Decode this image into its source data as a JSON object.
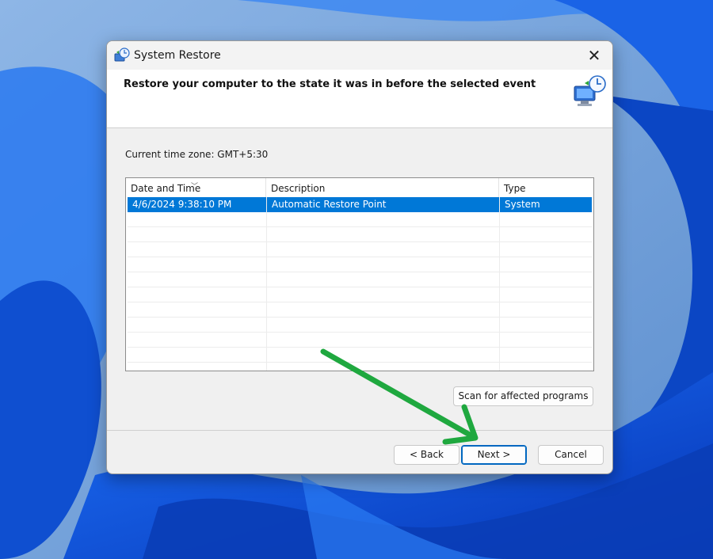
{
  "window": {
    "title": "System Restore",
    "close_glyph": "✕",
    "title_icon": "system-restore-icon"
  },
  "header": {
    "heading": "Restore your computer to the state it was in before the selected event",
    "icon": "system-restore-computer-icon"
  },
  "timezone": {
    "label": "Current time zone: GMT+5:30"
  },
  "restore_points": {
    "columns": [
      {
        "label": "Date and Time",
        "sorted": true
      },
      {
        "label": "Description"
      },
      {
        "label": "Type"
      }
    ],
    "rows": [
      {
        "date": "4/6/2024 9:38:10 PM",
        "description": "Automatic Restore Point",
        "type": "System",
        "selected": true
      }
    ]
  },
  "buttons": {
    "scan": "Scan for affected programs",
    "back": "< Back",
    "next": "Next >",
    "cancel": "Cancel"
  },
  "annotation": {
    "arrow_color": "#1fa83f",
    "points_to": "next-button"
  },
  "colors": {
    "selection": "#0078d7",
    "wallpaper_blue": "#0a4fd6",
    "primary_border": "#0067c0"
  }
}
